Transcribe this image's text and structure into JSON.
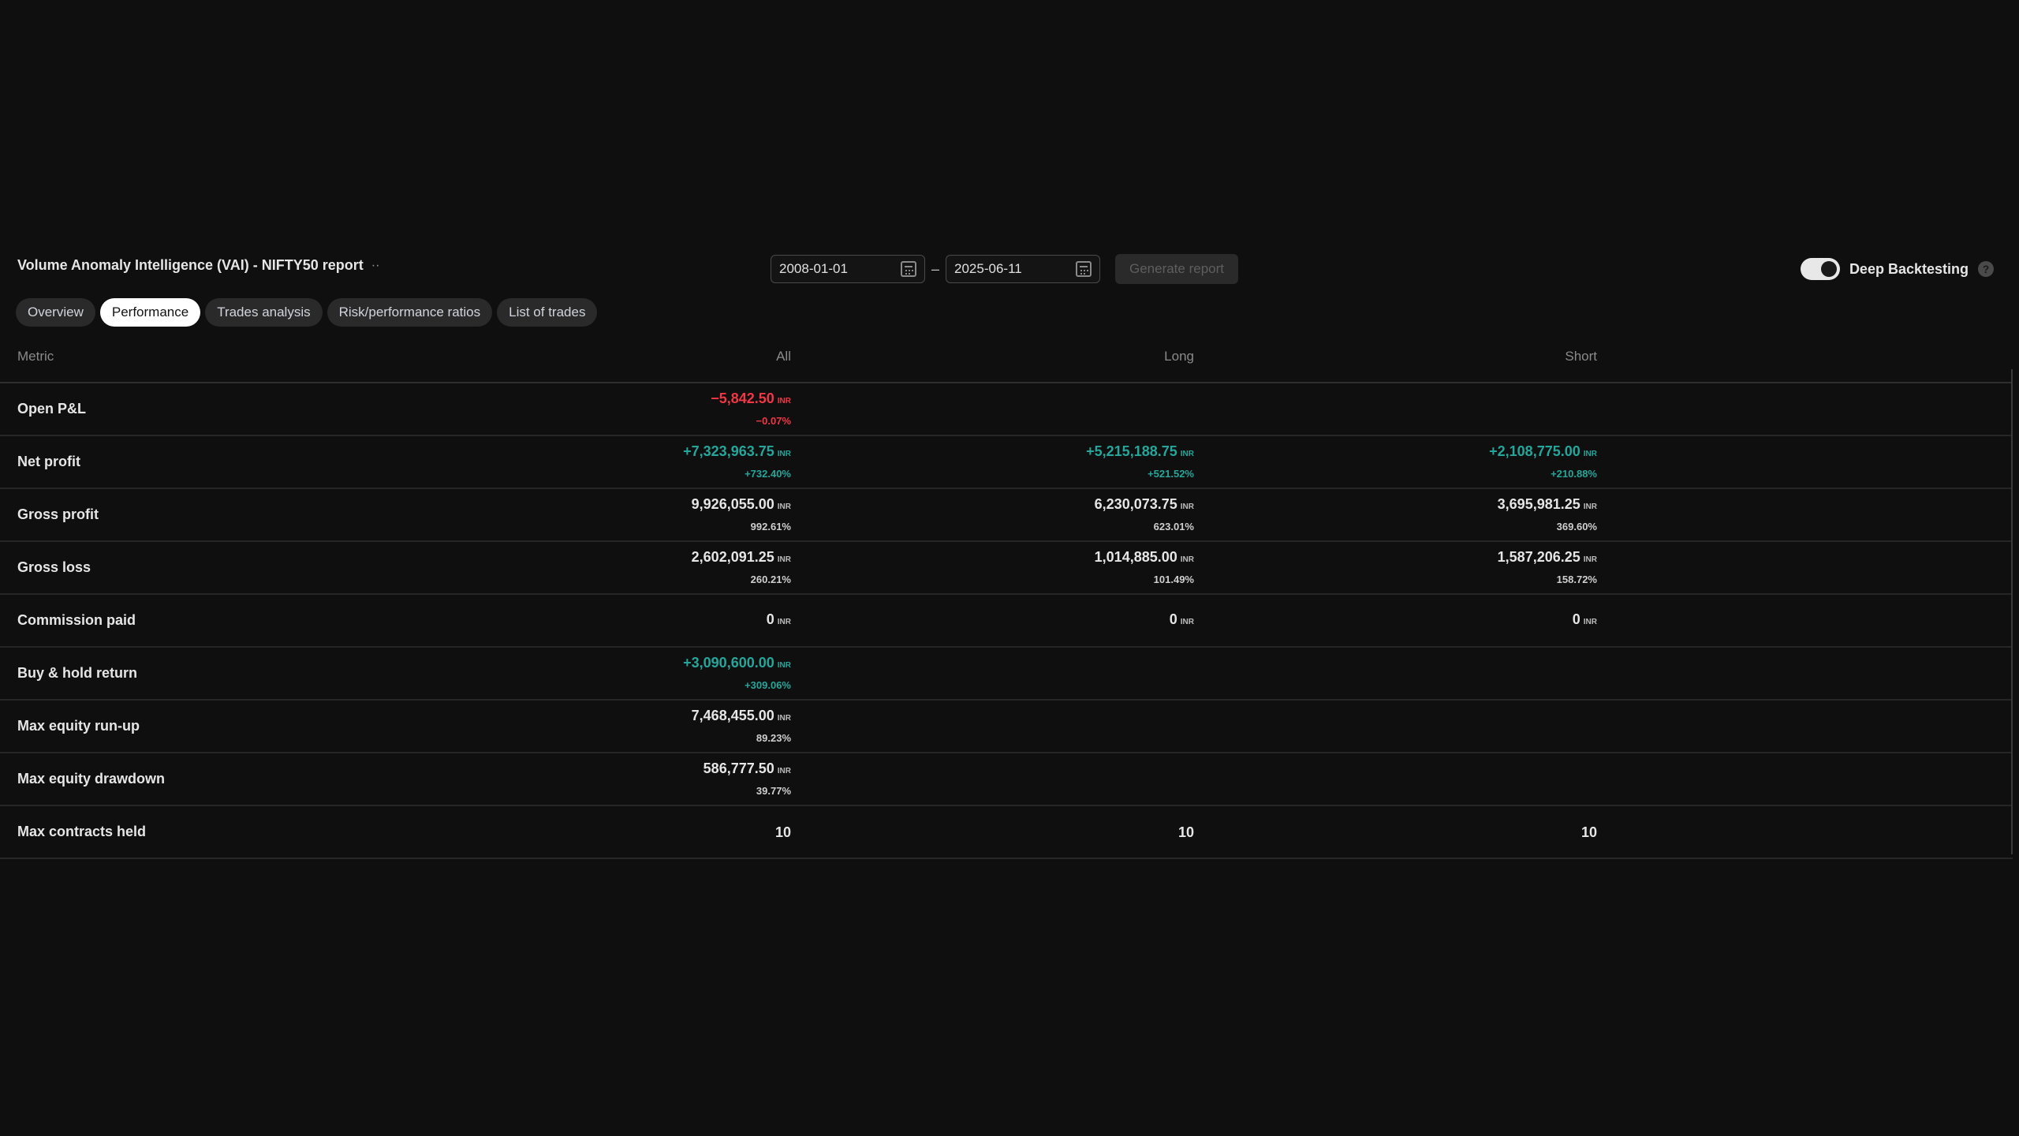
{
  "header": {
    "title": "Volume Anomaly Intelligence (VAI) - NIFTY50 report",
    "title_menu": "··",
    "start_date": "2008-01-01",
    "end_date": "2025-06-11",
    "date_separator": "–",
    "generate_label": "Generate report",
    "deep_backtesting_label": "Deep Backtesting",
    "deep_backtesting_on": true,
    "help_glyph": "?"
  },
  "tabs": [
    {
      "label": "Overview",
      "active": false
    },
    {
      "label": "Performance",
      "active": true
    },
    {
      "label": "Trades analysis",
      "active": false
    },
    {
      "label": "Risk/performance ratios",
      "active": false
    },
    {
      "label": "List of trades",
      "active": false
    }
  ],
  "table": {
    "headers": {
      "metric": "Metric",
      "all": "All",
      "long": "Long",
      "short": "Short"
    },
    "currency": "INR",
    "rows": [
      {
        "metric": "Open P&L",
        "all": {
          "value": "−5,842.50",
          "pct": "−0.07%",
          "tone": "neg"
        },
        "long": null,
        "short": null
      },
      {
        "metric": "Net profit",
        "all": {
          "value": "+7,323,963.75",
          "pct": "+732.40%",
          "tone": "pos"
        },
        "long": {
          "value": "+5,215,188.75",
          "pct": "+521.52%",
          "tone": "pos"
        },
        "short": {
          "value": "+2,108,775.00",
          "pct": "+210.88%",
          "tone": "pos"
        }
      },
      {
        "metric": "Gross profit",
        "all": {
          "value": "9,926,055.00",
          "pct": "992.61%",
          "tone": ""
        },
        "long": {
          "value": "6,230,073.75",
          "pct": "623.01%",
          "tone": ""
        },
        "short": {
          "value": "3,695,981.25",
          "pct": "369.60%",
          "tone": ""
        }
      },
      {
        "metric": "Gross loss",
        "all": {
          "value": "2,602,091.25",
          "pct": "260.21%",
          "tone": ""
        },
        "long": {
          "value": "1,014,885.00",
          "pct": "101.49%",
          "tone": ""
        },
        "short": {
          "value": "1,587,206.25",
          "pct": "158.72%",
          "tone": ""
        }
      },
      {
        "metric": "Commission paid",
        "all": {
          "value": "0",
          "pct": null,
          "tone": ""
        },
        "long": {
          "value": "0",
          "pct": null,
          "tone": ""
        },
        "short": {
          "value": "0",
          "pct": null,
          "tone": ""
        }
      },
      {
        "metric": "Buy & hold return",
        "all": {
          "value": "+3,090,600.00",
          "pct": "+309.06%",
          "tone": "pos"
        },
        "long": null,
        "short": null
      },
      {
        "metric": "Max equity run-up",
        "all": {
          "value": "7,468,455.00",
          "pct": "89.23%",
          "tone": ""
        },
        "long": null,
        "short": null
      },
      {
        "metric": "Max equity drawdown",
        "all": {
          "value": "586,777.50",
          "pct": "39.77%",
          "tone": ""
        },
        "long": null,
        "short": null
      },
      {
        "metric": "Max contracts held",
        "all": {
          "value": "10",
          "pct": null,
          "tone": "",
          "no_currency": true
        },
        "long": {
          "value": "10",
          "pct": null,
          "tone": "",
          "no_currency": true
        },
        "short": {
          "value": "10",
          "pct": null,
          "tone": "",
          "no_currency": true
        }
      }
    ]
  },
  "colors": {
    "background": "#0f0f0f",
    "positive": "#26a69a",
    "negative": "#f23645",
    "tab_active_bg": "#ffffff",
    "tab_bg": "#2a2a2a"
  }
}
